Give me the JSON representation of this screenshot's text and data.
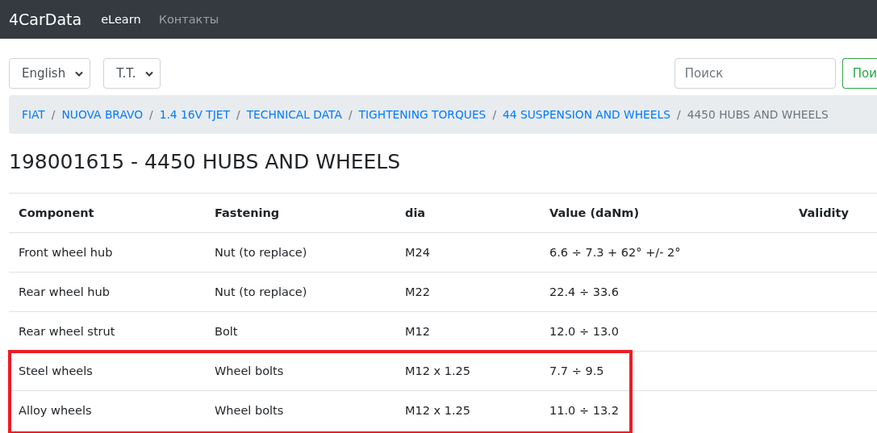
{
  "navbar": {
    "brand": "4CarData",
    "links": [
      {
        "label": "eLearn",
        "selected": true
      },
      {
        "label": "Контакты",
        "selected": false
      }
    ]
  },
  "toolbar": {
    "selects": [
      {
        "value": "English"
      },
      {
        "value": "T.T."
      }
    ],
    "search": {
      "placeholder": "Поиск"
    },
    "search_button": "Пои"
  },
  "breadcrumb_separator": "/",
  "breadcrumb": [
    {
      "label": "FIAT",
      "current": false
    },
    {
      "label": "NUOVA BRAVO",
      "current": false
    },
    {
      "label": "1.4 16V TJET",
      "current": false
    },
    {
      "label": "TECHNICAL DATA",
      "current": false
    },
    {
      "label": "TIGHTENING TORQUES",
      "current": false
    },
    {
      "label": "44 SUSPENSION AND WHEELS",
      "current": false
    },
    {
      "label": "4450 HUBS AND WHEELS",
      "current": true
    }
  ],
  "heading": "198001615 - 4450 HUBS AND WHEELS",
  "table": {
    "columns": [
      "Component",
      "Fastening",
      "dia",
      "Value (daNm)",
      "Validity"
    ],
    "rows": [
      {
        "cells": [
          "Front wheel hub",
          "Nut (to replace)",
          "M24",
          "6.6 ÷ 7.3 + 62° +/- 2°"
        ],
        "highlighted": false
      },
      {
        "cells": [
          "Rear wheel hub",
          "Nut (to replace)",
          "M22",
          "22.4 ÷ 33.6"
        ],
        "highlighted": false
      },
      {
        "cells": [
          "Rear wheel strut",
          "Bolt",
          "M12",
          "12.0 ÷ 13.0"
        ],
        "highlighted": false
      },
      {
        "cells": [
          "Steel wheels",
          "Wheel bolts",
          "M12 x 1.25",
          "7.7 ÷ 9.5"
        ],
        "highlighted": true
      },
      {
        "cells": [
          "Alloy wheels",
          "Wheel bolts",
          "M12 x 1.25",
          "11.0 ÷ 13.2"
        ],
        "highlighted": true
      }
    ]
  }
}
